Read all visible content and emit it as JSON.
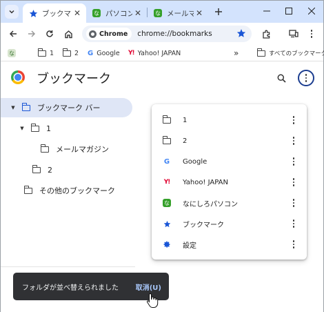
{
  "tabs": [
    {
      "title": "ブックマーク",
      "active": true,
      "favicon": "star-icon"
    },
    {
      "title": "パソコン用",
      "active": false,
      "favicon": "nanishiro-icon"
    },
    {
      "title": "メールマガ",
      "active": false,
      "favicon": "nanishiro-icon"
    }
  ],
  "toolbar": {
    "chip_label": "Chrome",
    "url": "chrome://bookmarks"
  },
  "bookmarks_bar": {
    "items": [
      {
        "label": "",
        "icon": "nanishiro-icon"
      },
      {
        "label": "1",
        "icon": "folder-icon"
      },
      {
        "label": "2",
        "icon": "folder-icon"
      },
      {
        "label": "Google",
        "icon": "google-icon"
      },
      {
        "label": "Yahoo! JAPAN",
        "icon": "yahoo-icon"
      }
    ],
    "overflow": "»",
    "all_bookmarks": "すべてのブックマーク"
  },
  "page": {
    "title": "ブックマーク"
  },
  "tree": [
    {
      "label": "ブックマーク バー",
      "expanded": true,
      "selected": true
    },
    {
      "label": "1",
      "expanded": true
    },
    {
      "label": "メールマガジン"
    },
    {
      "label": "2"
    },
    {
      "label": "その他のブックマーク"
    }
  ],
  "menu": {
    "items": [
      {
        "label": "1",
        "icon": "folder-icon"
      },
      {
        "label": "2",
        "icon": "folder-icon"
      },
      {
        "label": "Google",
        "icon": "google-icon"
      },
      {
        "label": "Yahoo! JAPAN",
        "icon": "yahoo-icon"
      },
      {
        "label": "なにしろパソコン",
        "icon": "nanishiro-icon"
      },
      {
        "label": "ブックマーク",
        "icon": "star-icon"
      },
      {
        "label": "設定",
        "icon": "gear-icon"
      }
    ]
  },
  "toast": {
    "message": "フォルダが並べ替えられました",
    "action": "取消(U)"
  },
  "colors": {
    "accent": "#1a56d6",
    "tabstrip": "#d3e3fd",
    "selected_row": "#dfe6f6",
    "toast_bg": "#303134"
  }
}
